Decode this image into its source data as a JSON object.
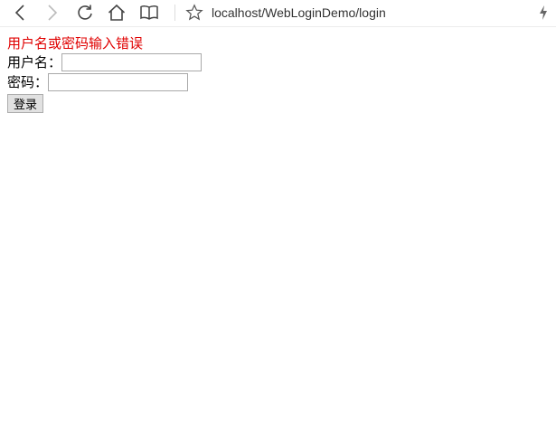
{
  "browser": {
    "url": "localhost/WebLoginDemo/login",
    "icons": {
      "back": "back-arrow-icon",
      "forward": "forward-arrow-icon",
      "refresh": "refresh-icon",
      "home": "home-icon",
      "reading": "reading-view-icon",
      "favorite": "star-icon",
      "extension": "lightning-icon"
    }
  },
  "page": {
    "error_message": "用户名或密码输入错误",
    "username_label": "用户名：",
    "username_value": "",
    "password_label": "密码：",
    "password_value": "",
    "login_button": "登录"
  },
  "colors": {
    "error": "#e00000",
    "icon": "#444444",
    "icon_disabled": "#bbbbbb"
  }
}
